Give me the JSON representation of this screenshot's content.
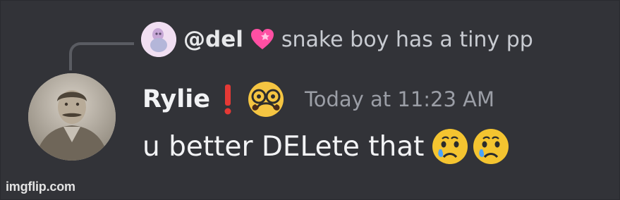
{
  "reply": {
    "username": "@del",
    "text": "snake boy has a tiny pp",
    "avatar_icon": "kid-avatar",
    "heart_icon": "pink-heart"
  },
  "message": {
    "username": "Rylie",
    "exclaim_icon": "red-exclamation",
    "badge_icon": "disguised-face-emoji",
    "timestamp": "Today at 11:23 AM",
    "text": "u better DELete that",
    "trailing_emojis": [
      "crying-face",
      "crying-face"
    ]
  },
  "watermark": "imgflip.com",
  "colors": {
    "background": "#323338",
    "text_primary": "#f2f3f5",
    "text_muted": "#9b9ea6",
    "accent_red": "#e53935",
    "heart_pink": "#ff4fa3"
  }
}
